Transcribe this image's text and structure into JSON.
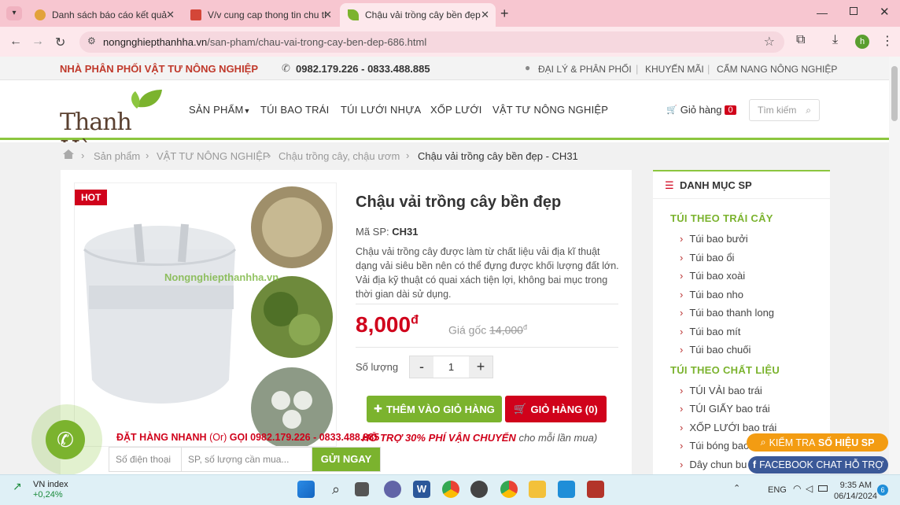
{
  "browser": {
    "tabs": [
      {
        "label": "Danh sách báo cáo kết quả thẩ",
        "icon": "document-icon",
        "color": "#e2a23b"
      },
      {
        "label": "V/v cung cap thong tin chu the",
        "icon": "gmail-icon",
        "color": "#d44638"
      },
      {
        "label": "Chậu vải trồng cây bền đẹp - C",
        "icon": "leaf-icon",
        "color": "#7bb32e"
      }
    ],
    "new_tab": "+",
    "url_domain": "nongnghiepthanhha.vn",
    "url_path": "/san-pham/chau-vai-trong-cay-ben-dep-686.html",
    "profile_initial": "h"
  },
  "topbar": {
    "distributor": "NHÀ PHÂN PHỐI VẬT TƯ NÔNG NGHIỆP",
    "phones": "0982.179.226 - 0833.488.885",
    "links": [
      "ĐẠI LÝ & PHÂN PHỐI",
      "KHUYẾN MÃI",
      "CẨM NANG NÔNG NGHIỆP"
    ]
  },
  "header": {
    "logo_text": "Thanh Hà",
    "menu": [
      "SẢN PHẨM",
      "TÚI BAO TRÁI",
      "TÚI LƯỚI NHỰA",
      "XỐP LƯỚI",
      "VẬT TƯ NÔNG NGHIỆP"
    ],
    "cart_label": "Giỏ hàng",
    "cart_count": "0",
    "search_placeholder": "Tìm kiếm"
  },
  "breadcrumb": [
    "Sản phẩm",
    "VẬT TƯ NÔNG NGHIỆP",
    "Chậu trồng cây, chậu ươm",
    "Chậu vải trồng cây bền đẹp - CH31"
  ],
  "product": {
    "badge": "HOT",
    "watermark": "Nongnghiepthanhha.vn",
    "title": "Chậu vải trồng cây bền đẹp",
    "sku_label": "Mã SP:",
    "sku": "CH31",
    "description": "Chậu vải trồng cây được làm từ chất liệu vải địa kĩ thuật dạng vải siêu bền nên có thể đựng được khối lượng đất lớn. Vải địa kỹ thuật có quai xách tiện lợi, không bai mục trong thời gian dài sử dụng.",
    "price": "8,000",
    "currency": "đ",
    "original_label": "Giá gốc",
    "original_price": "14,000",
    "qty_label": "Số lượng",
    "qty_value": "1",
    "add_to_cart": "THÊM VÀO GIỎ HÀNG",
    "cart_button": "GIỎ HÀNG (0)",
    "quick_order": "ĐẶT HÀNG NHANH",
    "quick_or": "(Or)",
    "quick_call": "GỌI 0982.179.226 - 0833.488.885",
    "shipping_promo": "HỖ TRỢ 30% PHÍ VẬN CHUYỂN",
    "shipping_tail": "cho mỗi lần mua)"
  },
  "quick_form": {
    "phone_placeholder": "Số điện thoại",
    "items_placeholder": "SP, số lượng cần mua...",
    "submit": "GỬI NGAY"
  },
  "sidebar": {
    "title": "DANH MỤC SP",
    "group1": "TÚI THEO TRÁI CÂY",
    "group1_items": [
      "Túi bao bưởi",
      "Túi bao ổi",
      "Túi bao xoài",
      "Túi bao nho",
      "Túi bao thanh long",
      "Túi bao mít",
      "Túi bao chuối"
    ],
    "group2": "TÚI THEO CHẤT LIỆU",
    "group2_items": [
      "TÚI VẢI bao trái",
      "TÚI GIẤY bao trái",
      "XỐP LƯỚI bao trái",
      "Túi bóng bao",
      "Dây chun bu"
    ]
  },
  "floating": {
    "check_serial_prefix": "KIỂM TRA",
    "check_serial_bold": "SỐ HIỆU SP",
    "facebook_chat": "FACEBOOK CHAT HỖ TRỢ"
  },
  "taskbar": {
    "market_name": "VN index",
    "market_change": "+0,24%",
    "language": "ENG",
    "time": "9:35 AM",
    "date": "06/14/2024",
    "notif_count": "6"
  },
  "colors": {
    "brand_green": "#8cc63f",
    "brand_red": "#d0021b",
    "price_red": "#d0021b",
    "tab_pink": "#f7c6d0"
  }
}
